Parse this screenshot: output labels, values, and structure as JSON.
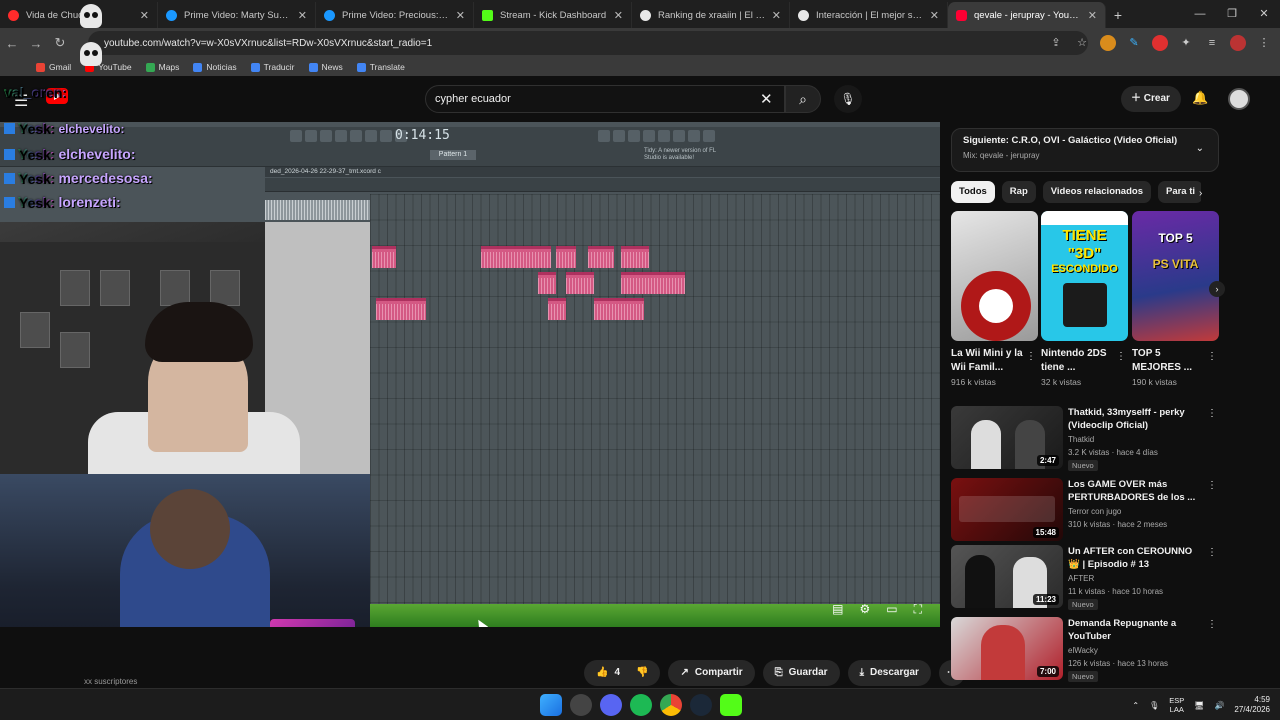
{
  "browser": {
    "tabs": [
      {
        "title": "Vida de Chuck",
        "color": "#ff2b2b",
        "active": false
      },
      {
        "title": "Prime Video: Marty Supremo",
        "color": "#1a98ff",
        "active": false
      },
      {
        "title": "Prime Video: Precious: Preciosa",
        "color": "#1a98ff",
        "active": false
      },
      {
        "title": "Stream - Kick Dashboard",
        "color": "#53fc18",
        "active": false
      },
      {
        "title": "Ranking de xraaiin | El mejor sc",
        "color": "#e8e8e8",
        "active": false
      },
      {
        "title": "Interacción | El mejor software",
        "color": "#e8e8e8",
        "active": false
      },
      {
        "title": "qevale - jerupray - YouTube",
        "color": "#ff0033",
        "active": true
      }
    ],
    "url": "youtube.com/watch?v=w-X0sVXrnuc&list=RDw-X0sVXrnuc&start_radio=1",
    "bookmarks": [
      {
        "label": "Gmail",
        "color": "#ea4335"
      },
      {
        "label": "YouTube",
        "color": "#ff0000"
      },
      {
        "label": "Maps",
        "color": "#34a853"
      },
      {
        "label": "Noticias",
        "color": "#4285f4"
      },
      {
        "label": "Traducir",
        "color": "#4285f4"
      },
      {
        "label": "News",
        "color": "#4285f4"
      },
      {
        "label": "Translate",
        "color": "#4285f4"
      }
    ]
  },
  "youtube": {
    "search_query": "cypher ecuador",
    "create_label": "Crear",
    "daw": {
      "time": "0:14:15",
      "pattern": "Pattern 1",
      "hint": "Tidy: A newer version of FL Studio is available!",
      "playlist_title": "ded_2026-04-26 22-29-37_tmt.xcord c"
    },
    "chat": [
      {
        "user": "Yesk:",
        "msg": "",
        "color": "#ff6de5"
      },
      {
        "user": "Yesk:",
        "msg": "elchevelito:",
        "color": "#ff6de5"
      },
      {
        "user": "Yesk:",
        "msg": "mercedesosa:",
        "color": "#ff6de5"
      },
      {
        "user": "Yesk:",
        "msg": "lorenzeti:",
        "color": "#ff6de5"
      }
    ],
    "chat_extra": {
      "user2": "val_oren:",
      "overlay_top": "elchevelito:"
    },
    "actions": {
      "likes": "4",
      "share": "Compartir",
      "save": "Guardar",
      "download": "Descargar"
    },
    "below_player_text": "xx suscriptores",
    "up_next": {
      "title": "Siguiente: C.R.O, OVI - Galáctico (Video Oficial)",
      "mix": "Mix: qevale - jerupray"
    },
    "chips": [
      "Todos",
      "Rap",
      "Videos relacionados",
      "Para ti"
    ],
    "shorts": [
      {
        "title": "La Wii Mini y la Wii Famil...",
        "views": "916 k vistas",
        "bg": "#c9c9c9",
        "accent": "#b01818"
      },
      {
        "title": "Nintendo 2DS tiene ...",
        "views": "32 k vistas",
        "bg": "#28c7e8",
        "accent": "#1b1b1b"
      },
      {
        "title": "TOP 5 MEJORES ...",
        "views": "190 k vistas",
        "bg": "#5a3a8a",
        "accent": "#e8c13b"
      }
    ],
    "shorts_badges": {
      "s2_line1": "TIENE",
      "s2_line2": "\"3D\"",
      "s2_line3": "ESCONDIDO",
      "s3_line1": "TOP 5",
      "s3_line2": "PS VITA"
    },
    "videos": [
      {
        "title": "Thatkid, 33myselff - perky (Videoclip Oficial)",
        "channel": "Thatkid",
        "meta": "3.2 K vistas · hace 4 días",
        "badge": "Nuevo",
        "duration": "2:47",
        "bg": "#2a2a2a"
      },
      {
        "title": "Los GAME OVER más PERTURBADORES de los ...",
        "channel": "Terror con jugo",
        "meta": "310 k vistas · hace 2 meses",
        "badge": "",
        "duration": "15:48",
        "bg": "#5a1010"
      },
      {
        "title": "Un AFTER con CEROUNNO 👑 | Episodio # 13",
        "channel": "AFTER",
        "meta": "11 k vistas · hace 10 horas",
        "badge": "Nuevo",
        "duration": "11:23",
        "bg": "#3a3a3a"
      },
      {
        "title": "Demanda Repugnante a YouTuber",
        "channel": "elWacky",
        "meta": "126 k vistas · hace 13 horas",
        "badge": "Nuevo",
        "duration": "7:00",
        "bg": "#b01f2a"
      }
    ]
  },
  "taskbar": {
    "lang1": "ESP",
    "lang2": "LAA",
    "time": "4:59",
    "date": "27/4/2026"
  }
}
